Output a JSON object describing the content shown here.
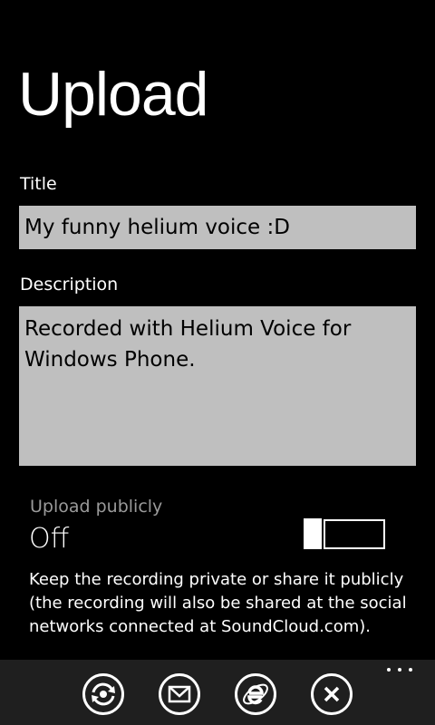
{
  "page": {
    "title": "Upload"
  },
  "form": {
    "title_label": "Title",
    "title_value": "My funny helium voice :D",
    "description_label": "Description",
    "description_value": "Recorded with Helium Voice for\nWindows Phone."
  },
  "toggle": {
    "header": "Upload publicly",
    "state_label": "Off",
    "is_on": false,
    "description": "Keep the recording private or share it publicly (the recording will also be shared at the social networks connected at SoundCloud.com)."
  },
  "app_bar": {
    "buttons": [
      {
        "icon": "sync-icon"
      },
      {
        "icon": "mail-icon"
      },
      {
        "icon": "internet-explorer-icon"
      },
      {
        "icon": "cancel-icon"
      }
    ]
  },
  "colors": {
    "background": "#000000",
    "input_background": "#bfbfbf",
    "app_bar_background": "#1f1f1f",
    "secondary_text": "#9a9a9a",
    "foreground": "#ffffff"
  }
}
